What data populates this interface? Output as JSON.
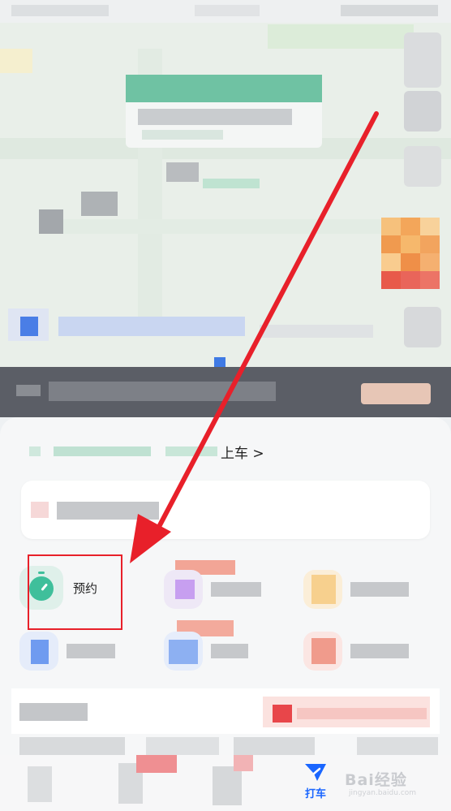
{
  "sheet": {
    "pickup_suffix": "上车 >"
  },
  "services": {
    "reserve_label": "预约"
  },
  "tabbar": {
    "dache_label": "打车"
  },
  "watermark": {
    "brand": "Bai经验",
    "sub": "jingyan.baidu.com"
  },
  "colors": {
    "accent": "#1a66ff",
    "reserve_icon": "#3fbf9b",
    "annotation_red": "#e8202a"
  }
}
